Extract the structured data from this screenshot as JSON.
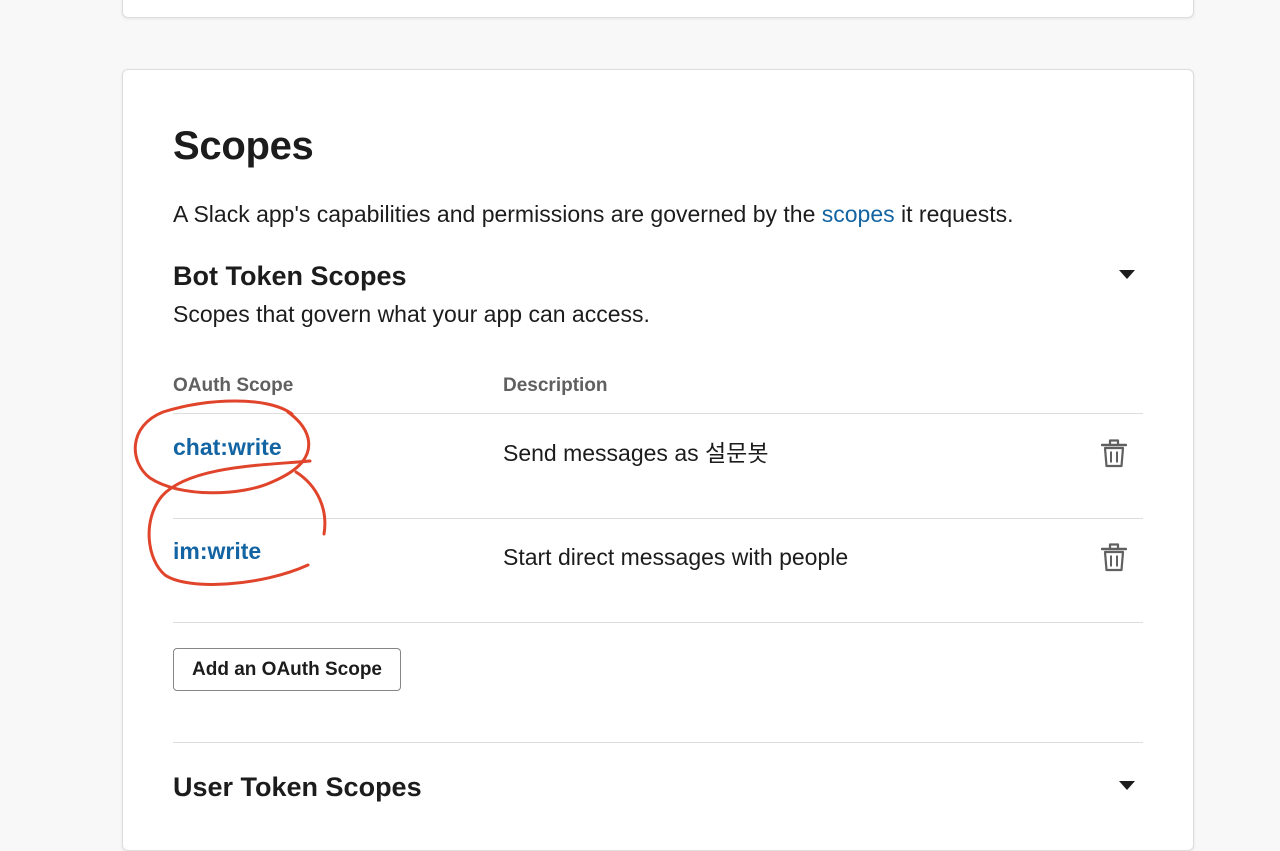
{
  "page": {
    "title": "Scopes",
    "intro_before": "A Slack app's capabilities and permissions are governed by the ",
    "intro_link": "scopes",
    "intro_after": " it requests."
  },
  "bot_scopes": {
    "title": "Bot Token Scopes",
    "subtitle": "Scopes that govern what your app can access.",
    "columns": {
      "scope": "OAuth Scope",
      "description": "Description"
    },
    "rows": [
      {
        "scope": "chat:write",
        "description": "Send messages as 설문봇"
      },
      {
        "scope": "im:write",
        "description": "Start direct messages with people"
      }
    ],
    "add_button": "Add an OAuth Scope"
  },
  "user_scopes": {
    "title": "User Token Scopes"
  },
  "colors": {
    "link": "#1264a3",
    "annotation": "#e0452c",
    "text": "#1d1c1d",
    "muted": "#616061",
    "divider": "#dddddd"
  },
  "icons": {
    "delete": "trash-icon",
    "expand": "caret-down-icon"
  }
}
